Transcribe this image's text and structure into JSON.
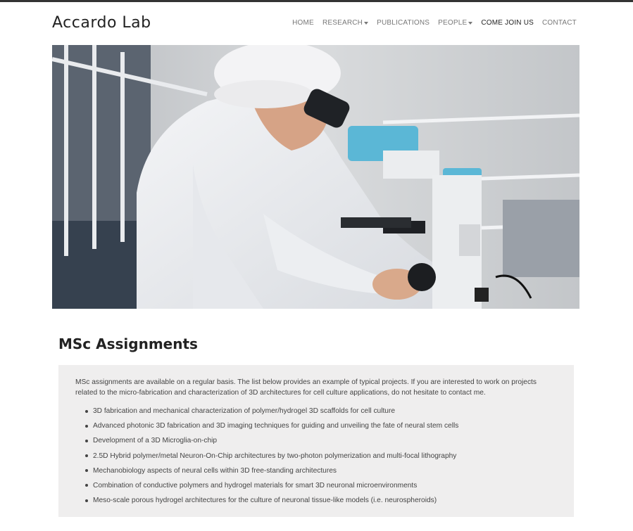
{
  "brand": "Accardo Lab",
  "nav": {
    "items": [
      {
        "label": "HOME",
        "dropdown": false
      },
      {
        "label": "RESEARCH",
        "dropdown": true
      },
      {
        "label": "PUBLICATIONS",
        "dropdown": false
      },
      {
        "label": "PEOPLE",
        "dropdown": true
      },
      {
        "label": "COME JOIN US",
        "dropdown": false,
        "active": true
      },
      {
        "label": "CONTACT",
        "dropdown": false
      }
    ]
  },
  "hero": {
    "icon": "photo-scientist-microscope"
  },
  "section": {
    "title": "MSc Assignments",
    "intro": "MSc assignments are available on a regular basis. The list below provides an example of typical projects. If you are interested to work on projects related to the micro-fabrication and characterization of 3D architectures for cell culture applications, do not hesitate to contact me.",
    "items": [
      "3D fabrication and mechanical characterization of polymer/hydrogel 3D scaffolds for cell culture",
      "Advanced photonic 3D fabrication and 3D imaging techniques for guiding and unveiling the fate of neural stem cells",
      "Development of a 3D Microglia-on-chip",
      "2.5D Hybrid polymer/metal Neuron-On-Chip architectures by two-photon polymerization and multi-focal lithography",
      "Mechanobiology aspects of neural cells within 3D free-standing architectures",
      "Combination of conductive polymers and hydrogel materials for smart 3D neuronal microenvironments",
      "Meso-scale porous hydrogel architectures for the culture of neuronal tissue-like models (i.e. neurospheroids)"
    ]
  }
}
